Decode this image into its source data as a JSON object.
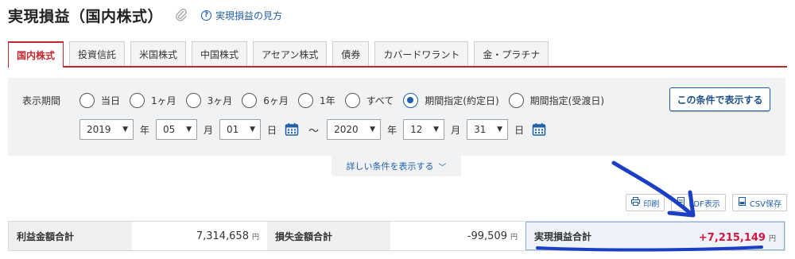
{
  "header": {
    "title": "実現損益（国内株式）",
    "help_label": "実現損益の見方"
  },
  "tabs": [
    {
      "label": "国内株式",
      "active": true
    },
    {
      "label": "投資信託",
      "active": false
    },
    {
      "label": "米国株式",
      "active": false
    },
    {
      "label": "中国株式",
      "active": false
    },
    {
      "label": "アセアン株式",
      "active": false
    },
    {
      "label": "債券",
      "active": false
    },
    {
      "label": "カバードワラント",
      "active": false
    },
    {
      "label": "金・プラチナ",
      "active": false
    }
  ],
  "filter": {
    "period_label": "表示期間",
    "options": [
      {
        "label": "当日",
        "checked": false
      },
      {
        "label": "1ヶ月",
        "checked": false
      },
      {
        "label": "3ヶ月",
        "checked": false
      },
      {
        "label": "6ヶ月",
        "checked": false
      },
      {
        "label": "1年",
        "checked": false
      },
      {
        "label": "すべて",
        "checked": false
      },
      {
        "label": "期間指定(約定日)",
        "checked": true
      },
      {
        "label": "期間指定(受渡日)",
        "checked": false
      }
    ],
    "apply_label": "この条件で表示する",
    "from": {
      "year": "2019",
      "month": "05",
      "day": "01"
    },
    "to": {
      "year": "2020",
      "month": "12",
      "day": "31"
    },
    "unit_year": "年",
    "unit_month": "月",
    "unit_day": "日",
    "separator": "～",
    "more_label": "詳しい条件を表示する"
  },
  "actions": {
    "print_label": "印刷",
    "pdf_label": "PDF表示",
    "csv_label": "CSV保存"
  },
  "summary": {
    "profit_label": "利益金額合計",
    "profit_value": "7,314,658",
    "loss_label": "損失金額合計",
    "loss_value": "-99,509",
    "total_label": "実現損益合計",
    "total_value": "+7,215,149",
    "yen": "円"
  },
  "colors": {
    "accent_red": "#c0282e",
    "link_blue": "#1f5fa8",
    "positive_value": "#d2163c",
    "annotation": "#1a3fc4"
  }
}
